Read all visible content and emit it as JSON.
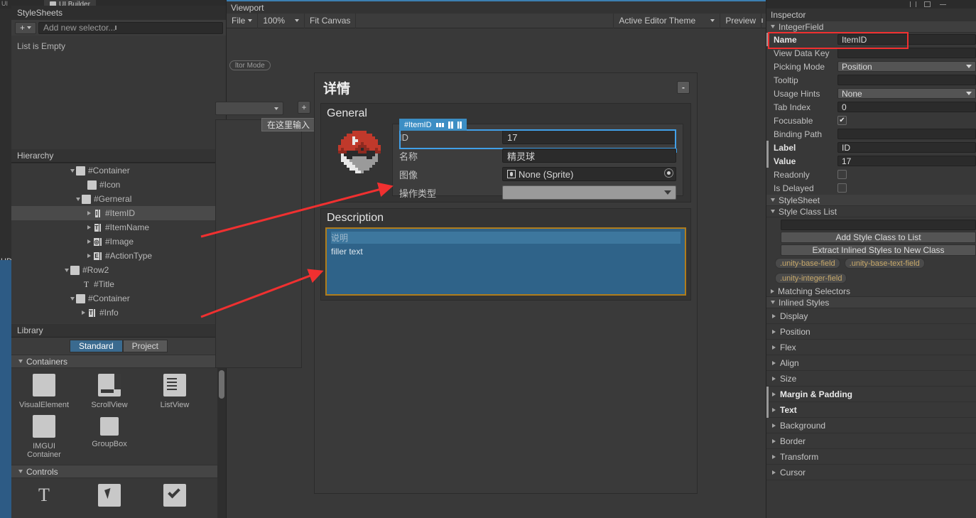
{
  "window": {
    "tab_label": "UI Builder",
    "tab_left_label": "UI"
  },
  "stylesheets": {
    "title": "StyleSheets",
    "add_button": "+",
    "search_placeholder": "Add new selector...",
    "empty_text": "List is Empty"
  },
  "hierarchy": {
    "title": "Hierarchy",
    "rows": [
      {
        "label": "#Container",
        "indent": 5,
        "icon": "visual-element",
        "twisty": "down",
        "selected": false
      },
      {
        "label": "#Icon",
        "indent": 6,
        "icon": "visual-element",
        "twisty": "none",
        "selected": false
      },
      {
        "label": "#Gerneral",
        "indent": 5.5,
        "icon": "visual-element",
        "twisty": "down",
        "selected": false
      },
      {
        "label": "#ItemID",
        "indent": 6.5,
        "icon": "integer-field",
        "twisty": "right",
        "selected": true
      },
      {
        "label": "#ItemName",
        "indent": 6.5,
        "icon": "text-field",
        "twisty": "right",
        "selected": false
      },
      {
        "label": "#Image",
        "indent": 6.5,
        "icon": "object-field",
        "twisty": "right",
        "selected": false
      },
      {
        "label": "#ActionType",
        "indent": 6.5,
        "icon": "enum-field",
        "twisty": "right",
        "selected": false
      },
      {
        "label": "#Row2",
        "indent": 4.5,
        "icon": "visual-element",
        "twisty": "down",
        "selected": false
      },
      {
        "label": "#Title",
        "indent": 5.5,
        "icon": "label",
        "twisty": "none",
        "selected": false
      },
      {
        "label": "#Container",
        "indent": 5,
        "icon": "visual-element",
        "twisty": "down",
        "selected": false
      },
      {
        "label": "#Info",
        "indent": 6,
        "icon": "text-field",
        "twisty": "right",
        "selected": false
      }
    ]
  },
  "library": {
    "title": "Library",
    "tabs": [
      {
        "label": "Standard",
        "active": true
      },
      {
        "label": "Project",
        "active": false
      }
    ],
    "sections": [
      {
        "title": "Containers",
        "items": [
          {
            "label": "VisualElement",
            "icon": "square-icon"
          },
          {
            "label": "ScrollView",
            "icon": "scrollview-icon"
          },
          {
            "label": "ListView",
            "icon": "listview-icon"
          },
          {
            "label": "IMGUI\nContainer",
            "icon": "square-icon"
          },
          {
            "label": "GroupBox",
            "icon": "square-small-icon"
          }
        ]
      },
      {
        "title": "Controls",
        "items": []
      }
    ]
  },
  "left_edge": {
    "hd_label": "HD"
  },
  "viewport": {
    "title": "Viewport",
    "toolbar": {
      "file_label": "File",
      "zoom_label": "100%",
      "fit_label": "Fit Canvas",
      "theme_label": "Active Editor Theme",
      "preview_label": "Preview"
    },
    "mode_pill": "ltor Mode",
    "tooltip": "在这里输入",
    "plus_label": "+"
  },
  "detail": {
    "title": "详情",
    "minimize_label": "-",
    "general": {
      "title": "General",
      "selection_badge": {
        "label": "#ItemID",
        "icons": [
          "move-icon",
          "align-icon",
          "anchor-icon"
        ]
      },
      "fields": [
        {
          "label": "ID",
          "value": "17",
          "type": "text",
          "selected": true
        },
        {
          "label": "名称",
          "value": "精灵球",
          "type": "text",
          "selected": false
        },
        {
          "label": "图像",
          "value": "None (Sprite)",
          "type": "object",
          "selected": false
        },
        {
          "label": "操作类型",
          "value": "",
          "type": "dropdown",
          "selected": false
        }
      ]
    },
    "description": {
      "title": "Description",
      "placeholder": "说明",
      "text": "filler text"
    }
  },
  "inspector": {
    "title": "Inspector",
    "element_section": "IntegerField",
    "properties": [
      {
        "label": "Name",
        "value": "ItemID",
        "type": "text",
        "bold": true,
        "marked": true
      },
      {
        "label": "View Data Key",
        "value": "",
        "type": "text",
        "bold": false,
        "marked": false
      },
      {
        "label": "Picking Mode",
        "value": "Position",
        "type": "dropdown",
        "bold": false,
        "marked": false
      },
      {
        "label": "Tooltip",
        "value": "",
        "type": "text",
        "bold": false,
        "marked": false
      },
      {
        "label": "Usage Hints",
        "value": "None",
        "type": "dropdown",
        "bold": false,
        "marked": false
      },
      {
        "label": "Tab Index",
        "value": "0",
        "type": "text",
        "bold": false,
        "marked": false
      },
      {
        "label": "Focusable",
        "value": "✔",
        "type": "checkbox",
        "bold": false,
        "marked": false,
        "checked": true
      },
      {
        "label": "Binding Path",
        "value": "",
        "type": "text",
        "bold": false,
        "marked": false
      },
      {
        "label": "Label",
        "value": "ID",
        "type": "text",
        "bold": true,
        "marked": true
      },
      {
        "label": "Value",
        "value": "17",
        "type": "text",
        "bold": true,
        "marked": true
      },
      {
        "label": "Readonly",
        "value": "",
        "type": "checkbox",
        "bold": false,
        "marked": false,
        "checked": false
      },
      {
        "label": "Is Delayed",
        "value": "",
        "type": "checkbox",
        "bold": false,
        "marked": false,
        "checked": false
      }
    ],
    "stylesheet": {
      "title": "StyleSheet",
      "style_class_list_title": "Style Class List",
      "input_value": "",
      "add_button": "Add Style Class to List",
      "extract_button": "Extract Inlined Styles to New Class",
      "classes": [
        ".unity-base-field",
        ".unity-base-text-field",
        ".unity-integer-field"
      ],
      "matching_selectors": "Matching Selectors"
    },
    "inlined_styles": {
      "title": "Inlined Styles",
      "categories": [
        {
          "label": "Display",
          "bold": false
        },
        {
          "label": "Position",
          "bold": false
        },
        {
          "label": "Flex",
          "bold": false
        },
        {
          "label": "Align",
          "bold": false
        },
        {
          "label": "Size",
          "bold": false
        },
        {
          "label": "Margin & Padding",
          "bold": true
        },
        {
          "label": "Text",
          "bold": true
        },
        {
          "label": "Background",
          "bold": false
        },
        {
          "label": "Border",
          "bold": false
        },
        {
          "label": "Transform",
          "bold": false
        },
        {
          "label": "Cursor",
          "bold": false
        }
      ]
    }
  },
  "colors": {
    "accent_blue": "#3c8ec4",
    "selection_outline": "#41a0e8",
    "annotation_red": "#f03030",
    "description_highlight": "#2f6389",
    "description_border": "#b07d1c",
    "chip_text": "#c8a96a",
    "panel_bg": "#383838"
  }
}
